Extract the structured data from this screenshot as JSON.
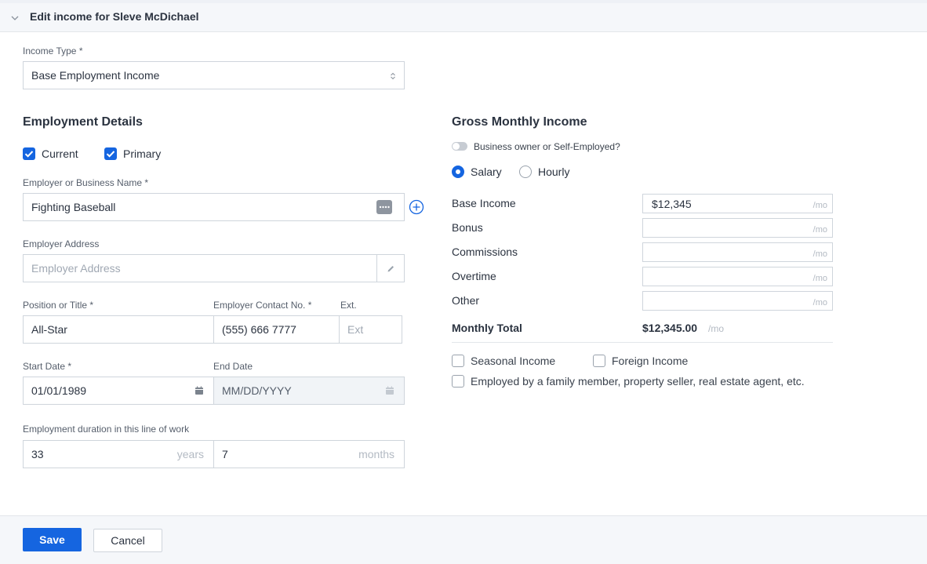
{
  "header": {
    "title": "Edit income for Sleve McDichael"
  },
  "income_type": {
    "label": "Income Type *",
    "value": "Base Employment Income"
  },
  "employment": {
    "title": "Employment Details",
    "current_label": "Current",
    "primary_label": "Primary",
    "current_checked": true,
    "primary_checked": true,
    "employer_name": {
      "label": "Employer or Business Name *",
      "value": "Fighting Baseball"
    },
    "employer_address": {
      "label": "Employer Address",
      "placeholder": "Employer Address"
    },
    "position": {
      "label": "Position or Title *",
      "value": "All-Star"
    },
    "contact": {
      "label": "Employer Contact No. *",
      "value": "(555) 666 7777"
    },
    "ext": {
      "label": "Ext.",
      "placeholder": "Ext"
    },
    "start_date": {
      "label": "Start Date *",
      "value": "01/01/1989"
    },
    "end_date": {
      "label": "End Date",
      "placeholder": "MM/DD/YYYY"
    },
    "duration": {
      "label": "Employment duration in this line of work",
      "years": "33",
      "years_unit": "years",
      "months": "7",
      "months_unit": "months"
    }
  },
  "gross": {
    "title": "Gross Monthly Income",
    "self_employed_label": "Business owner or Self-Employed?",
    "salary_label": "Salary",
    "hourly_label": "Hourly",
    "per_month": "/mo",
    "rows": [
      {
        "label": "Base Income",
        "value": "$12,345"
      },
      {
        "label": "Bonus",
        "value": ""
      },
      {
        "label": "Commissions",
        "value": ""
      },
      {
        "label": "Overtime",
        "value": ""
      },
      {
        "label": "Other",
        "value": ""
      }
    ],
    "total_label": "Monthly Total",
    "total_value": "$12,345.00",
    "seasonal_label": "Seasonal Income",
    "foreign_label": "Foreign Income",
    "family_label": "Employed by a family member, property seller, real estate agent, etc."
  },
  "footer": {
    "save_label": "Save",
    "cancel_label": "Cancel"
  },
  "colors": {
    "accent": "#1565e0"
  }
}
